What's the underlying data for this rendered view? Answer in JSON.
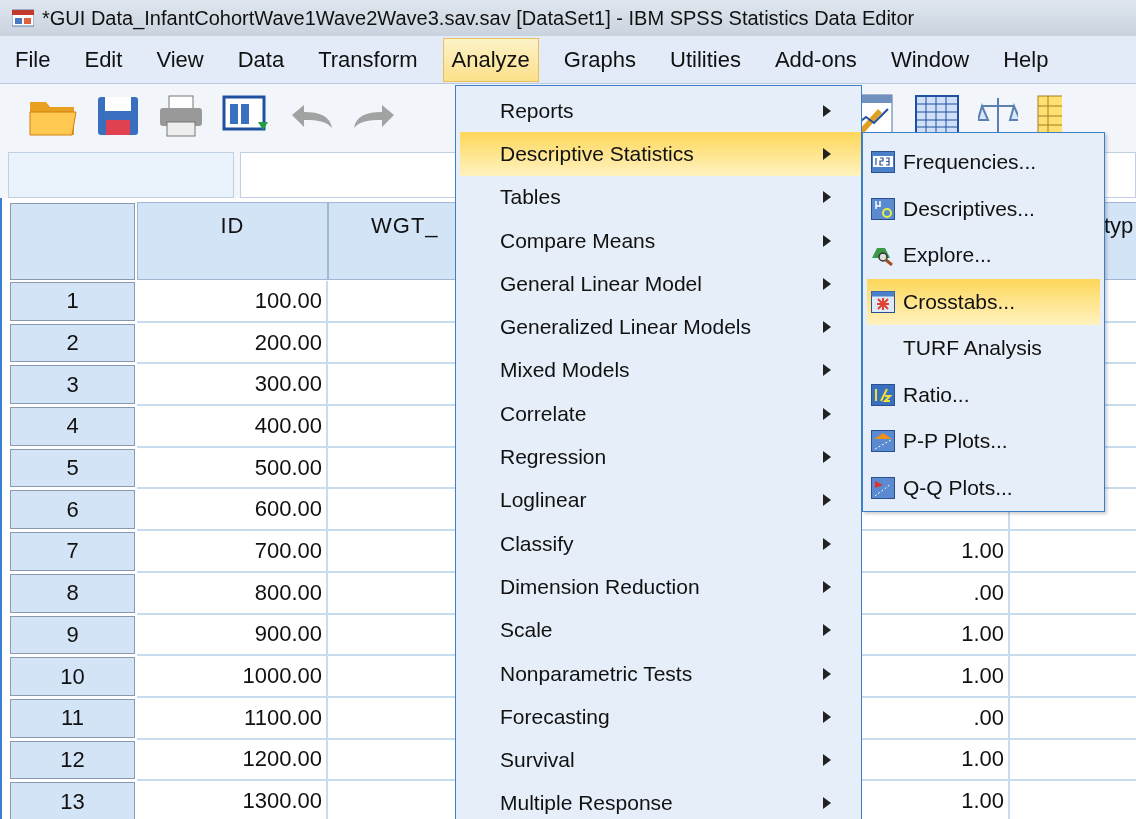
{
  "window": {
    "title": "*GUI Data_InfantCohortWave1Wave2Wave3.sav.sav [DataSet1] - IBM SPSS Statistics Data Editor"
  },
  "menubar": [
    {
      "label": "File",
      "selected": false
    },
    {
      "label": "Edit",
      "selected": false
    },
    {
      "label": "View",
      "selected": false
    },
    {
      "label": "Data",
      "selected": false
    },
    {
      "label": "Transform",
      "selected": false
    },
    {
      "label": "Analyze",
      "selected": true
    },
    {
      "label": "Graphs",
      "selected": false
    },
    {
      "label": "Utilities",
      "selected": false
    },
    {
      "label": "Add-ons",
      "selected": false
    },
    {
      "label": "Window",
      "selected": false
    },
    {
      "label": "Help",
      "selected": false
    }
  ],
  "table": {
    "columns": [
      {
        "label": "ID"
      },
      {
        "label": "WGT_"
      },
      {},
      {},
      {
        "label": "typ"
      }
    ],
    "rows": [
      {
        "number": "1",
        "id": "100.00"
      },
      {
        "number": "2",
        "id": "200.00"
      },
      {
        "number": "3",
        "id": "300.00"
      },
      {
        "number": "4",
        "id": "400.00"
      },
      {
        "number": "5",
        "id": "500.00"
      },
      {
        "number": "6",
        "id": "600.00"
      },
      {
        "number": "7",
        "id": "700.00",
        "column_4": "1.00"
      },
      {
        "number": "8",
        "id": "800.00",
        "column_4": ".00"
      },
      {
        "number": "9",
        "id": "900.00",
        "column_4": "1.00"
      },
      {
        "number": "10",
        "id": "1000.00",
        "column_4": "1.00"
      },
      {
        "number": "11",
        "id": "1100.00",
        "column_4": ".00"
      },
      {
        "number": "12",
        "id": "1200.00",
        "column_4": "1.00"
      },
      {
        "number": "13",
        "id": "1300.00",
        "column_4": "1.00"
      }
    ]
  },
  "analyze_menu": [
    {
      "label": "Reports",
      "selected": false
    },
    {
      "label": "Descriptive Statistics",
      "selected": true
    },
    {
      "label": "Tables",
      "selected": false
    },
    {
      "label": "Compare Means",
      "selected": false
    },
    {
      "label": "General Linear Model",
      "selected": false
    },
    {
      "label": "Generalized Linear Models",
      "selected": false
    },
    {
      "label": "Mixed Models",
      "selected": false
    },
    {
      "label": "Correlate",
      "selected": false
    },
    {
      "label": "Regression",
      "selected": false
    },
    {
      "label": "Loglinear",
      "selected": false
    },
    {
      "label": "Classify",
      "selected": false
    },
    {
      "label": "Dimension Reduction",
      "selected": false
    },
    {
      "label": "Scale",
      "selected": false
    },
    {
      "label": "Nonparametric Tests",
      "selected": false
    },
    {
      "label": "Forecasting",
      "selected": false
    },
    {
      "label": "Survival",
      "selected": false
    },
    {
      "label": "Multiple Response",
      "selected": false
    }
  ],
  "descriptive_submenu": [
    {
      "label": "Frequencies...",
      "selected": false,
      "kind": "frequencies"
    },
    {
      "label": "Descriptives...",
      "selected": false,
      "kind": "descriptives"
    },
    {
      "label": "Explore...",
      "selected": false,
      "kind": "explore"
    },
    {
      "label": "Crosstabs...",
      "selected": true,
      "kind": "crosstabs"
    },
    {
      "label": "TURF Analysis",
      "selected": false,
      "kind": "plain"
    },
    {
      "label": "Ratio...",
      "selected": false,
      "kind": "ratio"
    },
    {
      "label": "P-P Plots...",
      "selected": false,
      "kind": "pp"
    },
    {
      "label": "Q-Q Plots...",
      "selected": false,
      "kind": "qq"
    }
  ]
}
